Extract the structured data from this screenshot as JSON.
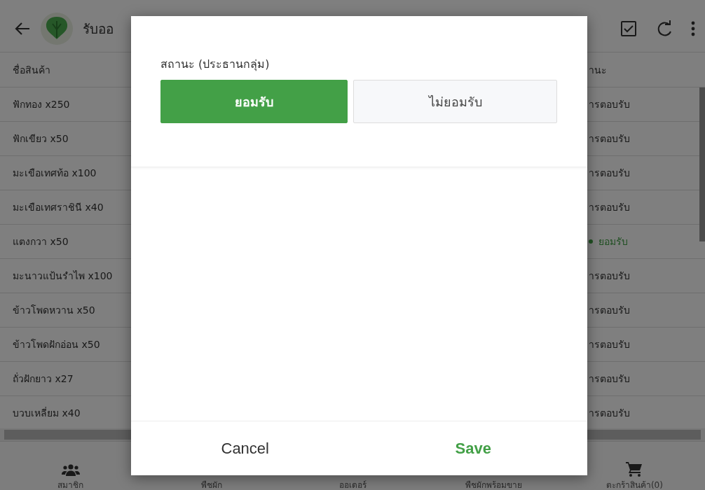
{
  "app_bar": {
    "title": "รับออ"
  },
  "table": {
    "columns": [
      "ชื่อสินค้า",
      "านะ"
    ],
    "rows": [
      {
        "name": "ฟักทอง x250",
        "status": "ารตอบรับ",
        "kind": "pending"
      },
      {
        "name": "ฟักเขียว x50",
        "status": "ารตอบรับ",
        "kind": "pending"
      },
      {
        "name": "มะเขือเทศท้อ x100",
        "status": "ารตอบรับ",
        "kind": "pending"
      },
      {
        "name": "มะเขือเทศราชินี x40",
        "status": "ารตอบรับ",
        "kind": "pending"
      },
      {
        "name": "แตงกวา x50",
        "status": "ยอมรับ",
        "kind": "accepted"
      },
      {
        "name": "มะนาวแป้นรำไพ x100",
        "status": "ารตอบรับ",
        "kind": "pending"
      },
      {
        "name": "ข้าวโพดหวาน x50",
        "status": "ารตอบรับ",
        "kind": "pending"
      },
      {
        "name": "ข้าวโพดฝักอ่อน x50",
        "status": "ารตอบรับ",
        "kind": "pending"
      },
      {
        "name": "ถั่วฝักยาว x27",
        "status": "ารตอบรับ",
        "kind": "pending"
      },
      {
        "name": "บวบเหลี่ยม x40",
        "status": "ารตอบรับ",
        "kind": "pending"
      }
    ]
  },
  "bottom_nav": [
    {
      "label": "สมาชิก",
      "kind": "members"
    },
    {
      "label": "พืชผัก"
    },
    {
      "label": "ออเดอร์"
    },
    {
      "label": "พืชผักพร้อมขาย"
    },
    {
      "label": "ตะกร้าสินค้า(0)",
      "kind": "cart"
    }
  ],
  "dialog": {
    "field_label": "สถานะ (ประธานกลุ่ม)",
    "options": [
      {
        "label": "ยอมรับ",
        "selected": true
      },
      {
        "label": "ไม่ยอมรับ",
        "selected": false
      }
    ],
    "cancel": "Cancel",
    "save": "Save"
  }
}
